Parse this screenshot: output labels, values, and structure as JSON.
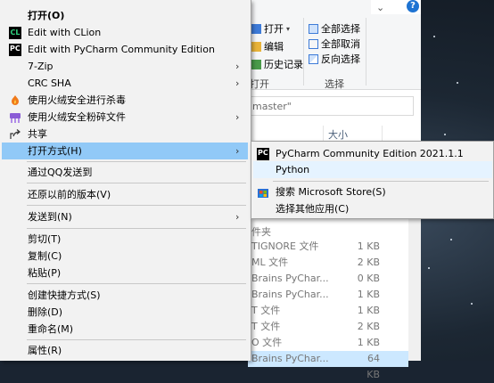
{
  "explorer": {
    "ribbon": {
      "open_label": "打开",
      "edit_label": "编辑",
      "history_label": "历史记录",
      "select_all_label": "全部选择",
      "select_none_label": "全部取消",
      "invert_selection_label": "反向选择",
      "group_open": "打开",
      "group_select": "选择"
    },
    "address": "master\"",
    "columns": {
      "size": "大小"
    },
    "folder_fragment": "件夹",
    "rows": [
      {
        "name": "TIGNORE 文件",
        "size": "1 KB"
      },
      {
        "name": "ML 文件",
        "size": "2 KB"
      },
      {
        "name": "Brains PyChar...",
        "size": "0 KB"
      },
      {
        "name": "Brains PyChar...",
        "size": "1 KB"
      },
      {
        "name": "T 文件",
        "size": "1 KB"
      },
      {
        "name": "T 文件",
        "size": "2 KB"
      },
      {
        "name": "O 文件",
        "size": "1 KB"
      },
      {
        "name": "Brains PyChar...",
        "size": "64 KB"
      }
    ],
    "help": "?"
  },
  "menu": {
    "items": [
      {
        "label": "打开(O)"
      },
      {
        "label": "Edit with CLion",
        "icon": "clion-icon"
      },
      {
        "label": "Edit with PyCharm Community Edition",
        "icon": "pycharm-icon"
      },
      {
        "label": "7-Zip"
      },
      {
        "label": "CRC SHA"
      },
      {
        "label": "使用火绒安全进行杀毒",
        "icon": "huorong-shield-icon"
      },
      {
        "label": "使用火绒安全粉碎文件",
        "icon": "shredder-icon"
      },
      {
        "label": "共享",
        "icon": "share-icon"
      },
      {
        "label": "打开方式(H)"
      },
      {
        "label": "通过QQ发送到"
      },
      {
        "label": "还原以前的版本(V)"
      },
      {
        "label": "发送到(N)"
      },
      {
        "label": "剪切(T)"
      },
      {
        "label": "复制(C)"
      },
      {
        "label": "粘贴(P)"
      },
      {
        "label": "创建快捷方式(S)"
      },
      {
        "label": "删除(D)"
      },
      {
        "label": "重命名(M)"
      },
      {
        "label": "属性(R)"
      }
    ],
    "arrow": "›"
  },
  "submenu": {
    "items": [
      {
        "label": "PyCharm Community Edition 2021.1.1",
        "icon": "pycharm-icon"
      },
      {
        "label": "Python"
      },
      {
        "label": "搜索 Microsoft Store(S)",
        "icon": "store-icon"
      },
      {
        "label": "选择其他应用(C)"
      }
    ]
  },
  "colors": {
    "menu_bg": "#f2f2f2",
    "highlight": "#91c9f7",
    "clion_green": "#2fd37f",
    "huorong_orange": "#f07a1a",
    "shredder_purple": "#8a5cd6"
  }
}
